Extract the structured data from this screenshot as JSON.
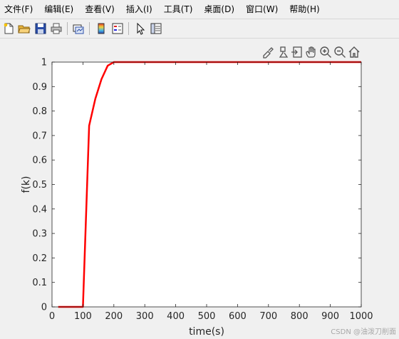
{
  "menu": [
    {
      "label": "文件(F)",
      "name": "menu-file"
    },
    {
      "label": "编辑(E)",
      "name": "menu-edit"
    },
    {
      "label": "查看(V)",
      "name": "menu-view"
    },
    {
      "label": "插入(I)",
      "name": "menu-insert"
    },
    {
      "label": "工具(T)",
      "name": "menu-tools"
    },
    {
      "label": "桌面(D)",
      "name": "menu-desktop"
    },
    {
      "label": "窗口(W)",
      "name": "menu-window"
    },
    {
      "label": "帮助(H)",
      "name": "menu-help"
    }
  ],
  "toolbar_icons": [
    "new-figure-icon",
    "open-file-icon",
    "save-icon",
    "print-icon",
    "link-plot-icon",
    "insert-colorbar-icon",
    "insert-legend-icon",
    "select-pointer-icon",
    "property-inspector-icon"
  ],
  "axes_toolbar_icons": [
    "brush-icon",
    "data-tip-icon",
    "export-icon",
    "pan-icon",
    "zoom-in-icon",
    "zoom-out-icon",
    "home-icon"
  ],
  "watermark": "CSDN @油泼刀削面",
  "chart_data": {
    "type": "line",
    "xlabel": "time(s)",
    "ylabel": "f(k)",
    "xlim": [
      0,
      1000
    ],
    "ylim": [
      0,
      1
    ],
    "xticks": [
      0,
      100,
      200,
      300,
      400,
      500,
      600,
      700,
      800,
      900,
      1000
    ],
    "yticks": [
      0,
      0.1,
      0.2,
      0.3,
      0.4,
      0.5,
      0.6,
      0.7,
      0.8,
      0.9,
      1
    ],
    "grid": false,
    "series": [
      {
        "color": "#ff0000",
        "x": [
          20,
          100,
          120,
          140,
          160,
          180,
          200,
          1000
        ],
        "y": [
          0,
          0,
          0.74,
          0.85,
          0.93,
          0.985,
          1,
          1
        ]
      }
    ]
  }
}
